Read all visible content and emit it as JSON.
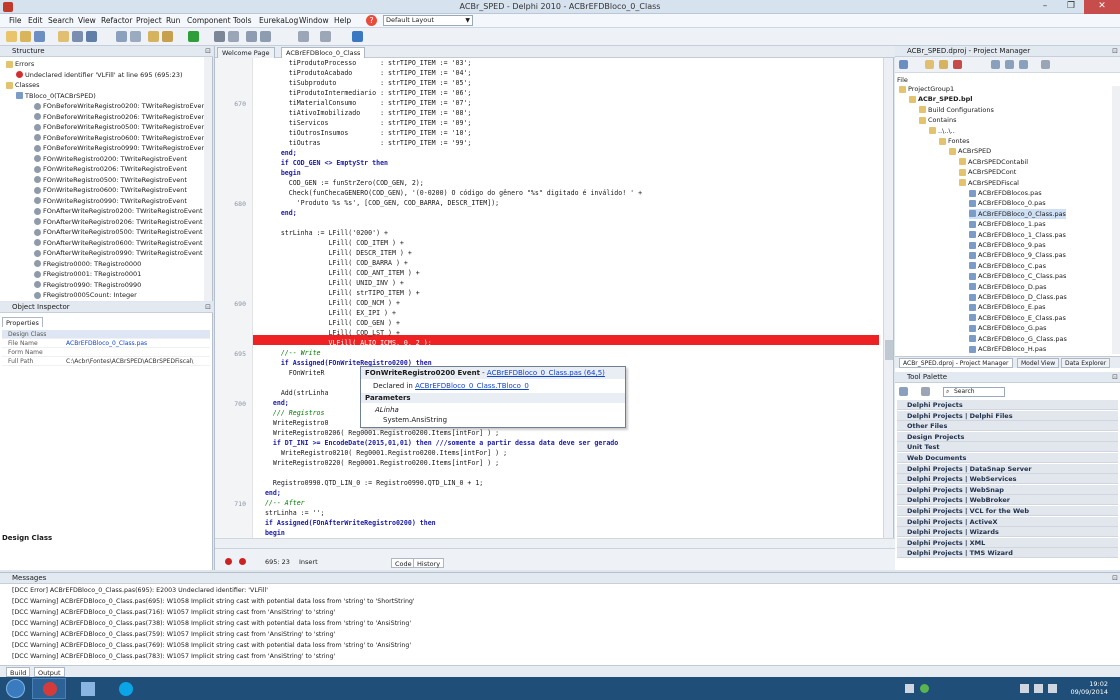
{
  "window": {
    "title": "ACBr_SPED - Delphi 2010 - ACBrEFDBloco_0_Class",
    "min": "–",
    "max": "❐",
    "close": "✕"
  },
  "menu": {
    "items": [
      "File",
      "Edit",
      "Search",
      "View",
      "Refactor",
      "Project",
      "Run",
      "Component",
      "Tools",
      "EurekaLog",
      "Window",
      "Help"
    ],
    "layout": "Default Layout"
  },
  "structure": {
    "title": "Structure",
    "rows": [
      "Errors",
      "Undeclared identifier 'VLFill' at line 695 (695:23)",
      "Classes",
      "TBloco_0(TACBrSPED)",
      "FOnBeforeWriteRegistro0200: TWriteRegistroEvent",
      "FOnBeforeWriteRegistro0206: TWriteRegistroEvent",
      "FOnBeforeWriteRegistro0500: TWriteRegistroEvent",
      "FOnBeforeWriteRegistro0600: TWriteRegistroEvent",
      "FOnBeforeWriteRegistro0990: TWriteRegistroEvent",
      "FOnWriteRegistro0200: TWriteRegistroEvent",
      "FOnWriteRegistro0206: TWriteRegistroEvent",
      "FOnWriteRegistro0500: TWriteRegistroEvent",
      "FOnWriteRegistro0600: TWriteRegistroEvent",
      "FOnWriteRegistro0990: TWriteRegistroEvent",
      "FOnAfterWriteRegistro0200: TWriteRegistroEvent",
      "FOnAfterWriteRegistro0206: TWriteRegistroEvent",
      "FOnAfterWriteRegistro0500: TWriteRegistroEvent",
      "FOnAfterWriteRegistro0600: TWriteRegistroEvent",
      "FOnAfterWriteRegistro0990: TWriteRegistroEvent",
      "FRegistro0000: TRegistro0000",
      "FRegistro0001: TRegistro0001",
      "FRegistro0990: TRegistro0990",
      "FRegistro0005Count: Integer"
    ]
  },
  "inspector": {
    "title": "Object Inspector",
    "tab": "Properties",
    "props": [
      {
        "k": "Design Class",
        "v": ""
      },
      {
        "k": "File Name",
        "v": "ACBrEFDBloco_0_Class.pas"
      },
      {
        "k": "Form Name",
        "v": ""
      },
      {
        "k": "Full Path",
        "v": "C:\\Acbr\\Fontes\\ACBrSPED\\ACBrSPEDFiscal\\"
      }
    ],
    "desc": "Design Class"
  },
  "editor": {
    "tabs": [
      "Welcome Page",
      "ACBrEFDBloco_0_Class"
    ],
    "line_numbers": [
      "670",
      "680",
      "690",
      "695",
      "700",
      "710"
    ],
    "lines": [
      "        tiProdutoProcesso      : strTIPO_ITEM := '03';",
      "        tiProdutoAcabado       : strTIPO_ITEM := '04';",
      "        tiSubproduto           : strTIPO_ITEM := '05';",
      "        tiProdutoIntermediario : strTIPO_ITEM := '06';",
      "        tiMaterialConsumo      : strTIPO_ITEM := '07';",
      "        tiAtivoImobilizado     : strTIPO_ITEM := '08';",
      "        tiServicos             : strTIPO_ITEM := '09';",
      "        tiOutrosInsumos        : strTIPO_ITEM := '10';",
      "        tiOutras               : strTIPO_ITEM := '99';",
      "      end;",
      "      if COD_GEN <> EmptyStr then",
      "      begin",
      "        COD_GEN := funStrZero(COD_GEN, 2);",
      "        Check(funChecaGENERO(COD_GEN), '(0-0200) O código do gênero \"%s\" digitado é inválido! ' +",
      "          'Produto %s %s', [COD_GEN, COD_BARRA, DESCR_ITEM]);",
      "      end;",
      "",
      "      strLinha := LFill('0200') +",
      "                  LFill( COD_ITEM ) +",
      "                  LFill( DESCR_ITEM ) +",
      "                  LFill( COD_BARRA ) +",
      "                  LFill( COD_ANT_ITEM ) +",
      "                  LFill( UNID_INV ) +",
      "                  LFill( strTIPO_ITEM ) +",
      "                  LFill( COD_NCM ) +",
      "                  LFill( EX_IPI ) +",
      "                  LFill( COD_GEN ) +",
      "                  LFill( COD_LST ) +",
      "                  VLFill( ALIQ_ICMS, 0, 2 );",
      "      //-- Write",
      "      if Assigned(FOnWriteRegistro0200) then",
      "        FOnWriteR",
      "",
      "      Add(strLinha",
      "    end;",
      "    /// Registros",
      "    WriteRegistro0",
      "    WriteRegistro0206( Reg0001.Registro0200.Items[intFor] ) ;",
      "    if DT_INI >= EncodeDate(2015,01,01) then ///somente a partir dessa data deve ser gerado",
      "      WriteRegistro0210( Reg0001.Registro0200.Items[intFor] ) ;",
      "    WriteRegistro0220( Reg0001.Registro0200.Items[intFor] ) ;",
      "",
      "    Registro0990.QTD_LIN_0 := Registro0990.QTD_LIN_0 + 1;",
      "  end;",
      "  //-- After",
      "  strLinha := '';",
      "  if Assigned(FOnAfterWriteRegistro0200) then",
      "  begin",
      "    FOnAfterWriteRegistro0200(strLinha);"
    ],
    "status_pos": "695: 23",
    "status_mode": "Insert",
    "bottom_tabs": [
      "Code",
      "History"
    ]
  },
  "tooltip": {
    "name": "FOnWriteRegistro0200 Event",
    "sep": " - ",
    "link": "ACBrEFDBloco_0_Class.pas (64,5)",
    "declared_label": "Declared in ",
    "declared_link": "ACBrEFDBloco_0_Class.TBloco_0",
    "params_label": "Parameters",
    "param_name": "ALinha",
    "param_type": "System.AnsiString"
  },
  "project_manager": {
    "title": "ACBr_SPED.dproj - Project Manager",
    "file_label": "File",
    "rows": [
      {
        "t": "ProjectGroup1",
        "i": 0
      },
      {
        "t": "ACBr_SPED.bpl",
        "i": 1
      },
      {
        "t": "Build Configurations",
        "i": 2
      },
      {
        "t": "Contains",
        "i": 2
      },
      {
        "t": "..\\..\\..",
        "i": 3
      },
      {
        "t": "Fontes",
        "i": 4
      },
      {
        "t": "ACBrSPED",
        "i": 5
      },
      {
        "t": "ACBrSPEDContabil",
        "i": 6
      },
      {
        "t": "ACBrSPEDCont",
        "i": 6
      },
      {
        "t": "ACBrSPEDFiscal",
        "i": 6
      },
      {
        "t": "ACBrEFDBlocos.pas",
        "i": 7
      },
      {
        "t": "ACBrEFDBloco_0.pas",
        "i": 7
      },
      {
        "t": "ACBrEFDBloco_0_Class.pas",
        "i": 7
      },
      {
        "t": "ACBrEFDBloco_1.pas",
        "i": 7
      },
      {
        "t": "ACBrEFDBloco_1_Class.pas",
        "i": 7
      },
      {
        "t": "ACBrEFDBloco_9.pas",
        "i": 7
      },
      {
        "t": "ACBrEFDBloco_9_Class.pas",
        "i": 7
      },
      {
        "t": "ACBrEFDBloco_C.pas",
        "i": 7
      },
      {
        "t": "ACBrEFDBloco_C_Class.pas",
        "i": 7
      },
      {
        "t": "ACBrEFDBloco_D.pas",
        "i": 7
      },
      {
        "t": "ACBrEFDBloco_D_Class.pas",
        "i": 7
      },
      {
        "t": "ACBrEFDBloco_E.pas",
        "i": 7
      },
      {
        "t": "ACBrEFDBloco_E_Class.pas",
        "i": 7
      },
      {
        "t": "ACBrEFDBloco_G.pas",
        "i": 7
      },
      {
        "t": "ACBrEFDBloco_G_Class.pas",
        "i": 7
      },
      {
        "t": "ACBrEFDBloco_H.pas",
        "i": 7
      }
    ],
    "tabs": [
      "ACBr_SPED.dproj - Project Manager",
      "Model View",
      "Data Explorer"
    ]
  },
  "tool_palette": {
    "title": "Tool Palette",
    "search_placeholder": "Search",
    "categories": [
      "Delphi Projects",
      "Delphi Projects | Delphi Files",
      "Other Files",
      "Design Projects",
      "Unit Test",
      "Web Documents",
      "Delphi Projects | DataSnap Server",
      "Delphi Projects | WebServices",
      "Delphi Projects | WebSnap",
      "Delphi Projects | WebBroker",
      "Delphi Projects | VCL for the Web",
      "Delphi Projects | ActiveX",
      "Delphi Projects | Wizards",
      "Delphi Projects | XML",
      "Delphi Projects | TMS Wizard"
    ]
  },
  "messages": {
    "title": "Messages",
    "lines": [
      "[DCC Error] ACBrEFDBloco_0_Class.pas(695): E2003 Undeclared identifier: 'VLFill'",
      "[DCC Warning] ACBrEFDBloco_0_Class.pas(695): W1058 Implicit string cast with potential data loss from 'string' to 'ShortString'",
      "[DCC Warning] ACBrEFDBloco_0_Class.pas(716): W1057 Implicit string cast from 'AnsiString' to 'string'",
      "[DCC Warning] ACBrEFDBloco_0_Class.pas(738): W1058 Implicit string cast with potential data loss from 'string' to 'AnsiString'",
      "[DCC Warning] ACBrEFDBloco_0_Class.pas(759): W1057 Implicit string cast from 'AnsiString' to 'string'",
      "[DCC Warning] ACBrEFDBloco_0_Class.pas(769): W1058 Implicit string cast with potential data loss from 'string' to 'AnsiString'",
      "[DCC Warning] ACBrEFDBloco_0_Class.pas(783): W1057 Implicit string cast from 'AnsiString' to 'string'"
    ],
    "tabs": [
      "Build",
      "Output"
    ]
  },
  "taskbar": {
    "time": "19:02",
    "date": "09/09/2014"
  },
  "colors": {
    "error_line": "#ee2222",
    "keyword": "#1a1aa6",
    "comment": "#008000",
    "link": "#1144cc"
  }
}
